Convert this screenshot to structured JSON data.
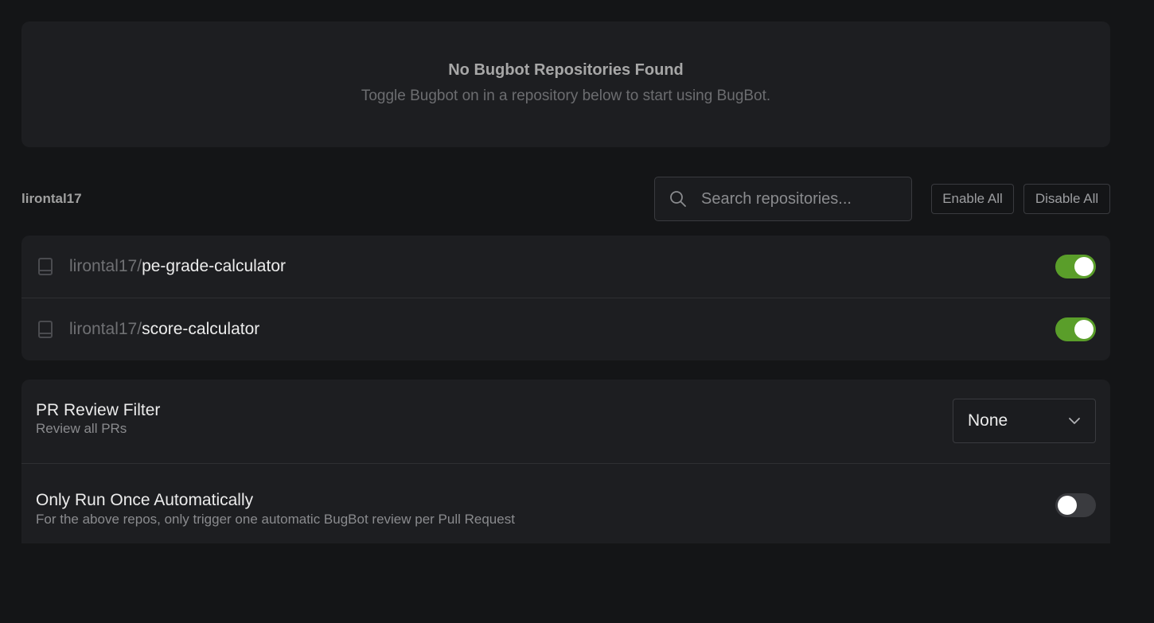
{
  "empty_state": {
    "title": "No Bugbot Repositories Found",
    "subtitle": "Toggle Bugbot on in a repository below to start using BugBot."
  },
  "owner": {
    "label": "lirontal17"
  },
  "search": {
    "placeholder": "Search repositories..."
  },
  "actions": {
    "enable_all": "Enable All",
    "disable_all": "Disable All"
  },
  "repositories": [
    {
      "owner_prefix": "lirontal17/",
      "name": "pe-grade-calculator",
      "enabled": true,
      "icon": "repo-book-icon"
    },
    {
      "owner_prefix": "lirontal17/",
      "name": "score-calculator",
      "enabled": true,
      "icon": "repo-book-icon"
    }
  ],
  "settings": {
    "pr_review_filter": {
      "title": "PR Review Filter",
      "description": "Review all PRs",
      "selected": "None",
      "icon": "chevron-down-icon"
    },
    "run_once": {
      "title": "Only Run Once Automatically",
      "description": "For the above repos, only trigger one automatic BugBot review per Pull Request",
      "enabled": false
    }
  },
  "colors": {
    "background": "#141517",
    "card": "#1d1e21",
    "toggle_on": "#5a9e2a",
    "toggle_off": "#3a3b3f",
    "border": "#3a3b3f"
  }
}
